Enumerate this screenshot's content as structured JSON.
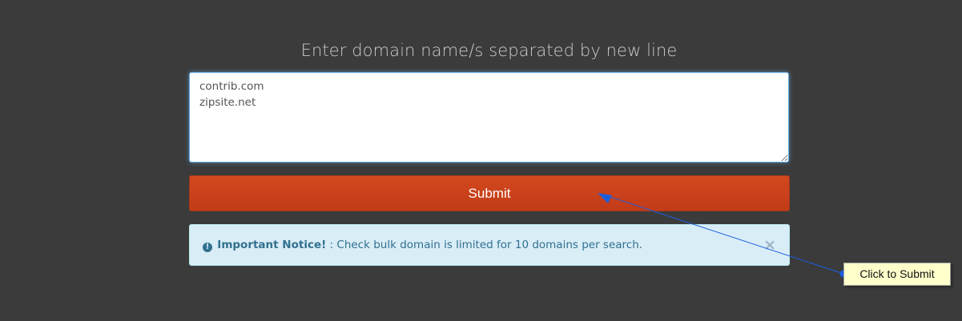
{
  "form": {
    "heading": "Enter domain name/s separated by new line",
    "domains_value": "contrib.com\nzipsite.net",
    "submit_label": "Submit"
  },
  "notice": {
    "icon": "exclamation-circle-icon",
    "title": "Important Notice!",
    "message": " : Check bulk domain is limited for 10 domains per search.",
    "close_label": "×"
  },
  "annotation": {
    "tooltip_text": "Click to Submit",
    "arrow_color": "#1a5fe0"
  },
  "colors": {
    "background": "#3b3b3b",
    "submit_button": "#c9421b",
    "notice_background": "#d9edf7",
    "notice_text": "#31708f",
    "tooltip_background": "#ffffcc"
  }
}
